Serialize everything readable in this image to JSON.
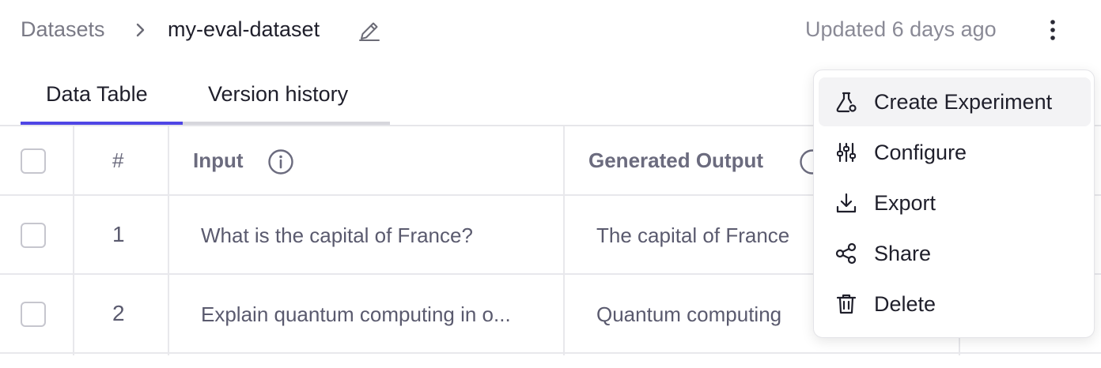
{
  "breadcrumb": {
    "root": "Datasets",
    "current": "my-eval-dataset"
  },
  "header": {
    "updated": "Updated 6 days ago"
  },
  "tabs": [
    {
      "label": "Data Table",
      "active": true
    },
    {
      "label": "Version history",
      "active": false
    }
  ],
  "table": {
    "columns": {
      "hash": "#",
      "input": "Input",
      "generated_output": "Generated Output"
    },
    "rows": [
      {
        "num": "1",
        "input": "What is the capital of France?",
        "output": "The capital of France"
      },
      {
        "num": "2",
        "input": "Explain quantum computing in o...",
        "output": "Quantum computing"
      }
    ]
  },
  "menu": {
    "items": [
      {
        "label": "Create Experiment",
        "icon": "flask-icon",
        "highlighted": true
      },
      {
        "label": "Configure",
        "icon": "sliders-icon"
      },
      {
        "label": "Export",
        "icon": "download-icon"
      },
      {
        "label": "Share",
        "icon": "share-icon"
      },
      {
        "label": "Delete",
        "icon": "trash-icon"
      }
    ]
  },
  "colors": {
    "accent": "#4f46e5",
    "text": "#1f1f2b",
    "muted": "#7a7a86"
  }
}
